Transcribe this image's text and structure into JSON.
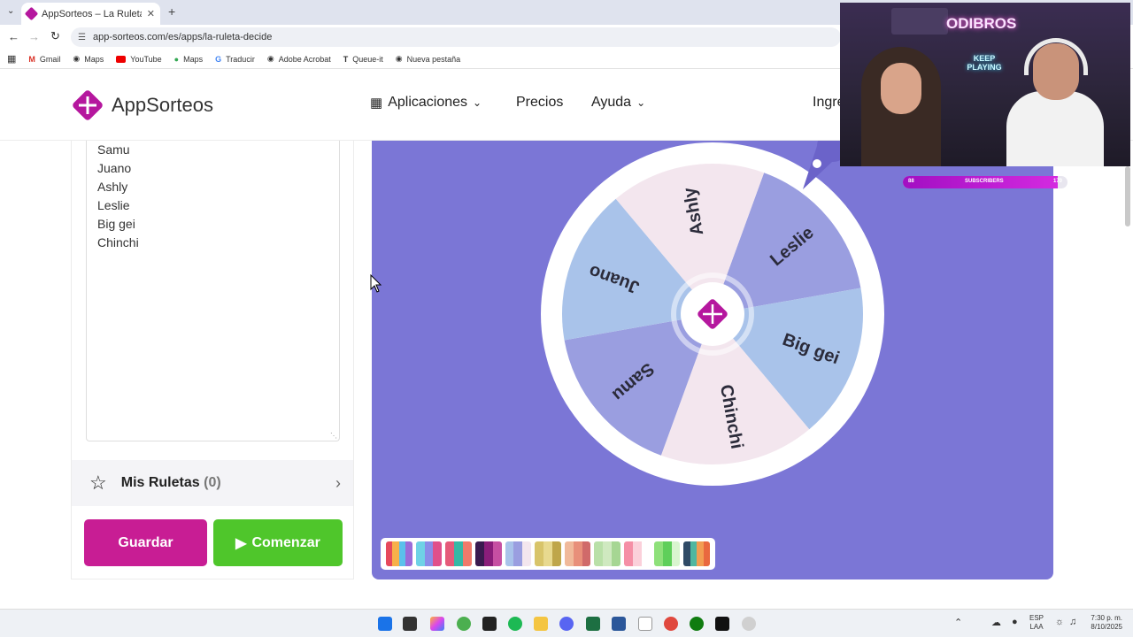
{
  "browser": {
    "tab_title": "AppSorteos – La Ruleta de la S...",
    "url": "app-sorteos.com/es/apps/la-ruleta-decide",
    "bookmarks": [
      "Gmail",
      "Maps",
      "YouTube",
      "Maps",
      "Traducir",
      "Adobe Acrobat",
      "Queue-it",
      "Nueva pestaña"
    ]
  },
  "site": {
    "logo_text_a": "App",
    "logo_text_b": "Sorteos",
    "nav": {
      "apps": "Aplicaciones",
      "prices": "Precios",
      "help": "Ayuda",
      "login": "Ingre"
    }
  },
  "participants": [
    "Samu",
    "Juano",
    "Ashly",
    "Leslie",
    "Big gei",
    "Chinchi"
  ],
  "mis_ruletas": {
    "label": "Mis Ruletas",
    "count": "(0)"
  },
  "buttons": {
    "save": "Guardar",
    "start": "Comenzar"
  },
  "wheel": {
    "segments": [
      {
        "label": "Leslie",
        "color": "#9a9ee0"
      },
      {
        "label": "Big gei",
        "color": "#a9c3ea"
      },
      {
        "label": "Chinchi",
        "color": "#f3e6ee"
      },
      {
        "label": "Samu",
        "color": "#9a9ee0"
      },
      {
        "label": "Juano",
        "color": "#a9c3ea"
      },
      {
        "label": "Ashly",
        "color": "#f3e6ee"
      }
    ]
  },
  "palettes": [
    [
      "#e6495c",
      "#f7b04a",
      "#5bc0eb",
      "#9a6cd9"
    ],
    [
      "#6fd2e6",
      "#8a8de8",
      "#e0508b"
    ],
    [
      "#e55a7a",
      "#35b8a5",
      "#f07a6a"
    ],
    [
      "#3a1a4f",
      "#8a1d7a",
      "#c64fa2"
    ],
    [
      "#a9c3ea",
      "#9a9ee0",
      "#f3e6ee"
    ],
    [
      "#d8c46a",
      "#e8d98f",
      "#bfa64a"
    ],
    [
      "#f0b99a",
      "#e88f7a",
      "#d06a6a"
    ],
    [
      "#b9e0a8",
      "#cfe9c0",
      "#a6d693"
    ],
    [
      "#f58fa6",
      "#fbd0da",
      "#ffffff"
    ],
    [
      "#8ee07a",
      "#5fcf5a",
      "#d9f5cf"
    ],
    [
      "#2f4a66",
      "#50b7a0",
      "#f29d52",
      "#e9683f"
    ]
  ],
  "stream": {
    "brand": "ODIBROS",
    "neon": "KEEP PLAYING",
    "subscribers_label": "SUBSCRIBERS",
    "sub_left": "88",
    "sub_right": "170"
  },
  "taskbar": {
    "lang_top": "ESP",
    "lang_bottom": "LAA",
    "time": "7:30 p. m.",
    "date": "8/10/2025"
  }
}
